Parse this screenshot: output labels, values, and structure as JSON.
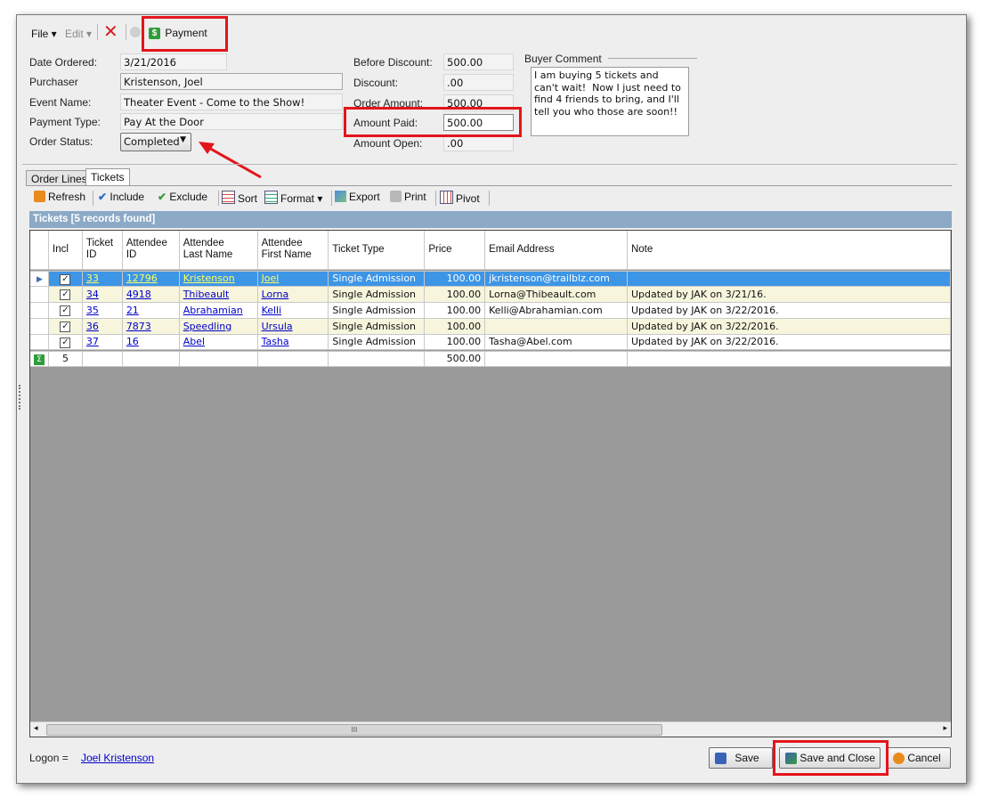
{
  "menu": {
    "file": "File",
    "edit": "Edit",
    "payment": "Payment"
  },
  "order": {
    "date_ordered_label": "Date Ordered:",
    "date_ordered": "3/21/2016",
    "purchaser_label": "Purchaser",
    "purchaser": "Kristenson, Joel",
    "event_label": "Event Name:",
    "event": "Theater Event - Come to the Show!",
    "payment_type_label": "Payment Type:",
    "payment_type": "Pay At the Door",
    "status_label": "Order Status:",
    "status": "Completed",
    "before_discount_label": "Before Discount:",
    "before_discount": "500.00",
    "discount_label": "Discount:",
    "discount": ".00",
    "order_amount_label": "Order Amount:",
    "order_amount": "500.00",
    "amount_paid_label": "Amount Paid:",
    "amount_paid": "500.00",
    "amount_open_label": "Amount Open:",
    "amount_open": ".00",
    "buyer_comment_label": "Buyer Comment",
    "buyer_comment": "I am buying 5 tickets and can't wait!  Now I just need to find 4 friends to bring, and I'll tell you who those are soon!!"
  },
  "tabs": {
    "order_lines": "Order Lines",
    "tickets": "Tickets"
  },
  "toolbar": {
    "refresh": "Refresh",
    "include": "Include",
    "exclude": "Exclude",
    "sort": "Sort",
    "format": "Format",
    "export": "Export",
    "print": "Print",
    "pivot": "Pivot"
  },
  "grid": {
    "title": "Tickets [5 records found]",
    "headers": {
      "incl": "Incl",
      "ticket_id_1": "Ticket",
      "ticket_id_2": "ID",
      "attendee_id_1": "Attendee",
      "attendee_id_2": "ID",
      "last_1": "Attendee",
      "last_2": "Last Name",
      "first_1": "Attendee",
      "first_2": "First Name",
      "type": "Ticket Type",
      "price": "Price",
      "email": "Email Address",
      "note": "Note"
    },
    "rows": [
      {
        "ticket_id": "33",
        "attendee_id": "12796",
        "last": "Kristenson",
        "first": "Joel",
        "type": "Single Admission",
        "price": "100.00",
        "email": "jkristenson@trailblz.com",
        "note": ""
      },
      {
        "ticket_id": "34",
        "attendee_id": "4918",
        "last": "Thibeault",
        "first": "Lorna",
        "type": "Single Admission",
        "price": "100.00",
        "email": "Lorna@Thibeault.com",
        "note": "Updated by JAK on 3/21/16."
      },
      {
        "ticket_id": "35",
        "attendee_id": "21",
        "last": "Abrahamian",
        "first": "Kelli",
        "type": "Single Admission",
        "price": "100.00",
        "email": "Kelli@Abrahamian.com",
        "note": "Updated by JAK on 3/22/2016."
      },
      {
        "ticket_id": "36",
        "attendee_id": "7873",
        "last": "Speedling",
        "first": "Ursula",
        "type": "Single Admission",
        "price": "100.00",
        "email": "",
        "note": "Updated by JAK on 3/22/2016."
      },
      {
        "ticket_id": "37",
        "attendee_id": "16",
        "last": "Abel",
        "first": "Tasha",
        "type": "Single Admission",
        "price": "100.00",
        "email": "Tasha@Abel.com",
        "note": "Updated by JAK on 3/22/2016."
      }
    ],
    "footer": {
      "count": "5",
      "total": "500.00"
    },
    "scroll_thumb": "III"
  },
  "bottom": {
    "logon_label": "Logon =",
    "logon_user": "Joel Kristenson",
    "save": "Save",
    "save_close": "Save and Close",
    "cancel": "Cancel"
  },
  "colors": {
    "highlight_red": "#e3151a",
    "selected_row": "#3d95e6",
    "alt_row": "#f7f5dc",
    "grid_title": "#8ca9c6"
  }
}
